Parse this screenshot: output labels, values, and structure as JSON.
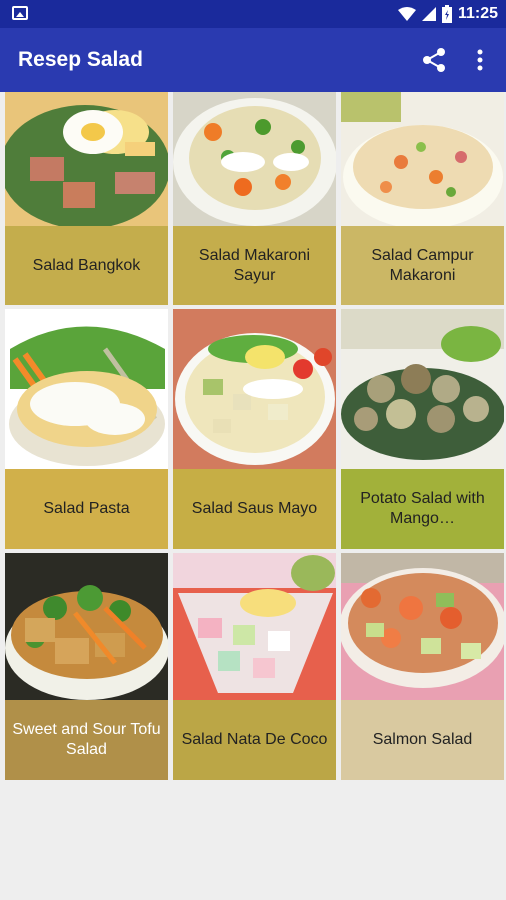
{
  "status": {
    "time": "11:25"
  },
  "appbar": {
    "title": "Resep Salad"
  },
  "tiles": [
    {
      "label": "Salad Bangkok",
      "bg": "#c4ad4c"
    },
    {
      "label": "Salad Makaroni Sayur",
      "bg": "#c4ad4c"
    },
    {
      "label": "Salad Campur Makaroni",
      "bg": "#cbb765"
    },
    {
      "label": "Salad Pasta",
      "bg": "#d1b04a"
    },
    {
      "label": "Salad Saus Mayo",
      "bg": "#c6ae45"
    },
    {
      "label": "Potato Salad with Mango…",
      "bg": "#a2b13a"
    },
    {
      "label": "Sweet and Sour Tofu Salad",
      "bg": "#b09049"
    },
    {
      "label": "Salad Nata De Coco",
      "bg": "#bba646"
    },
    {
      "label": "Salmon Salad",
      "bg": "#d9c9a0"
    }
  ]
}
